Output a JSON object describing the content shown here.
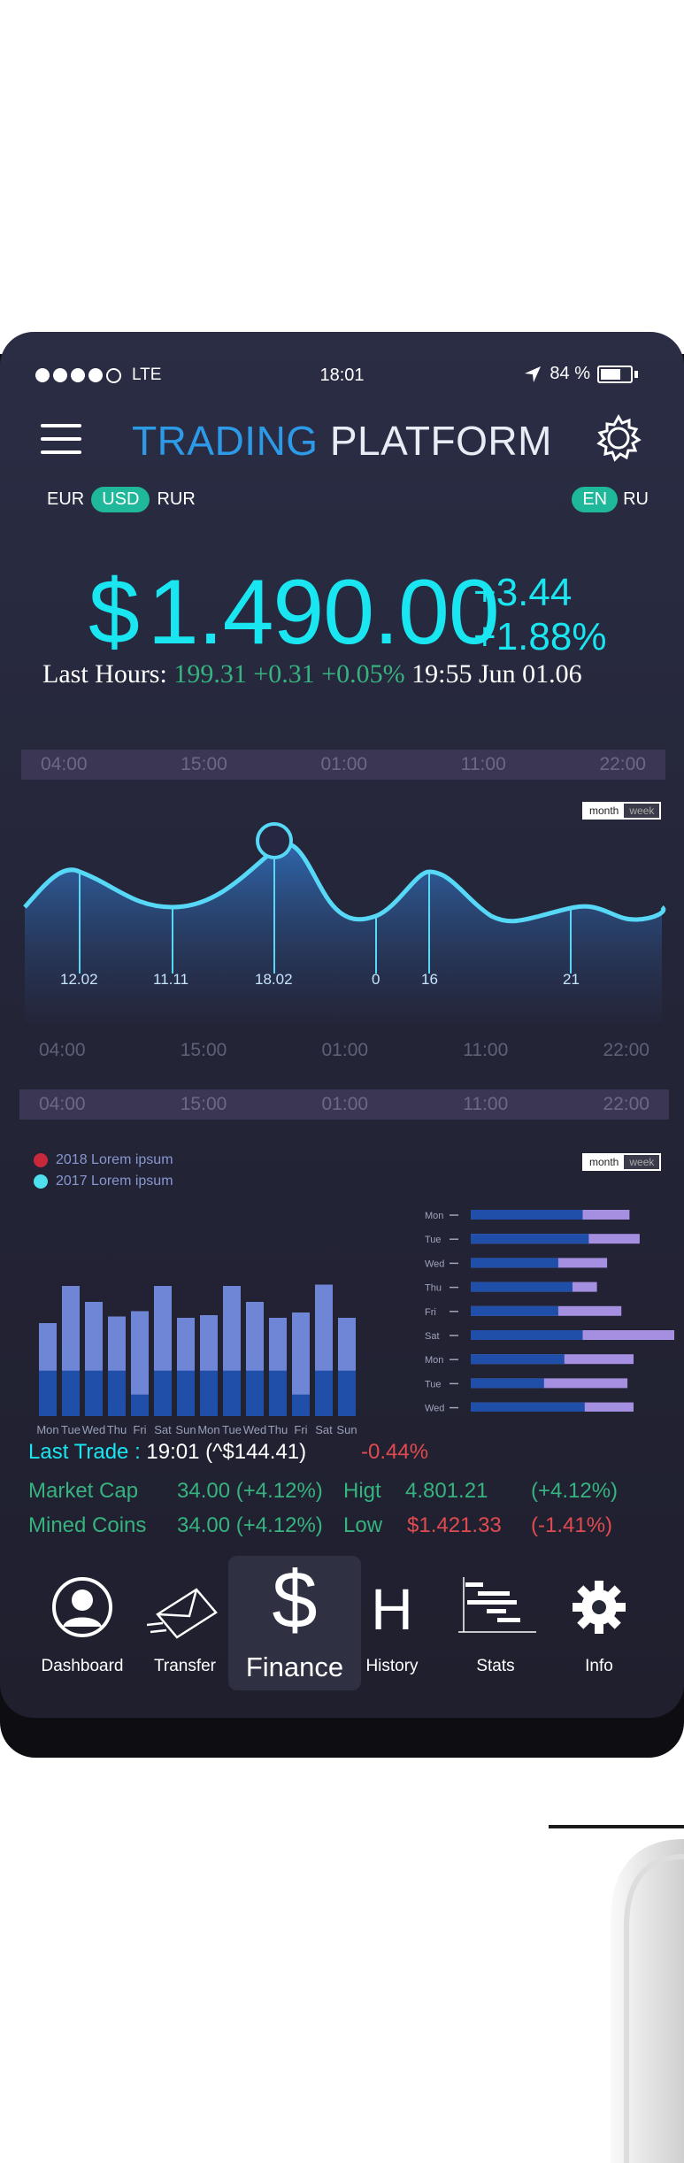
{
  "status": {
    "signal_text": "LTE",
    "time": "18:01",
    "battery": "84 %"
  },
  "header": {
    "title_part1": "TRADING",
    "title_part2": "PLATFORM"
  },
  "currencies": [
    "EUR",
    "USD",
    "RUR"
  ],
  "selected_currency": "USD",
  "languages": [
    "EN",
    "RU"
  ],
  "selected_language": "EN",
  "price": {
    "symbol": "$",
    "value": "1.490.00",
    "change_abs": "+3.44",
    "change_pct": "+1.88%"
  },
  "last_hours": {
    "label": "Last Hours:",
    "value": "199.31",
    "change": "+0.31",
    "pct": "+0.05%",
    "timestamp": "19:55 Jun 01.06"
  },
  "time_axis": [
    "04:00",
    "15:00",
    "01:00",
    "11:00",
    "22:00"
  ],
  "toggle": {
    "month": "month",
    "week": "week"
  },
  "line_chart": {
    "labels": [
      "12.02",
      "11.11",
      "18.02",
      "0",
      "16",
      "21"
    ]
  },
  "bar_legend": [
    {
      "label": "2018 Lorem ipsum",
      "color": "#c8283a"
    },
    {
      "label": "2017 Lorem ipsum",
      "color": "#4fe0f0"
    }
  ],
  "bar_chart": {
    "days": [
      "Mon",
      "Tue",
      "Wed",
      "Thu",
      "Fri",
      "Sat",
      "Sun",
      "Mon",
      "Tue",
      "Wed",
      "Thu",
      "Fri",
      "Sat",
      "Sun"
    ],
    "totals": [
      0.7,
      0.98,
      0.86,
      0.75,
      0.79,
      0.98,
      0.74,
      0.76,
      0.98,
      0.86,
      0.74,
      0.78,
      0.99,
      0.74
    ],
    "dark": [
      0.38,
      0.38,
      0.38,
      0.38,
      0.18,
      0.38,
      0.38,
      0.38,
      0.38,
      0.38,
      0.38,
      0.18,
      0.38,
      0.38
    ]
  },
  "hbar_chart": {
    "days": [
      "Mon",
      "Tue",
      "Wed",
      "Thu",
      "Fri",
      "Sat",
      "Mon",
      "Tue",
      "Wed"
    ],
    "blue": [
      0.55,
      0.58,
      0.43,
      0.5,
      0.43,
      0.55,
      0.46,
      0.36,
      0.56
    ],
    "total": [
      0.78,
      0.83,
      0.67,
      0.62,
      0.74,
      1.0,
      0.8,
      0.77,
      0.8
    ]
  },
  "trade": {
    "label": "Last Trade :",
    "value": "19:01 (^$144.41)",
    "pct": "-0.44%"
  },
  "market": [
    {
      "label": "Market Cap",
      "value": "34.00 (+4.12%)"
    },
    {
      "label": "Mined Coins",
      "value": "34.00 (+4.12%)"
    }
  ],
  "highlow": [
    {
      "label": "Higt",
      "value": "4.801.21",
      "pct": "(+4.12%)",
      "color": "#36b37e"
    },
    {
      "label": "Low",
      "value": "$1.421.33",
      "pct": "(-1.41%)",
      "color": "#e04b50"
    }
  ],
  "nav": [
    "Dashboard",
    "Transfer",
    "Finance",
    "History",
    "Stats",
    "Info"
  ],
  "colors": {
    "accent_cyan": "#19e6f0",
    "accent_blue": "#2d9ae8",
    "green": "#36b37e",
    "red": "#e04b50",
    "teal": "#1fb89a"
  }
}
